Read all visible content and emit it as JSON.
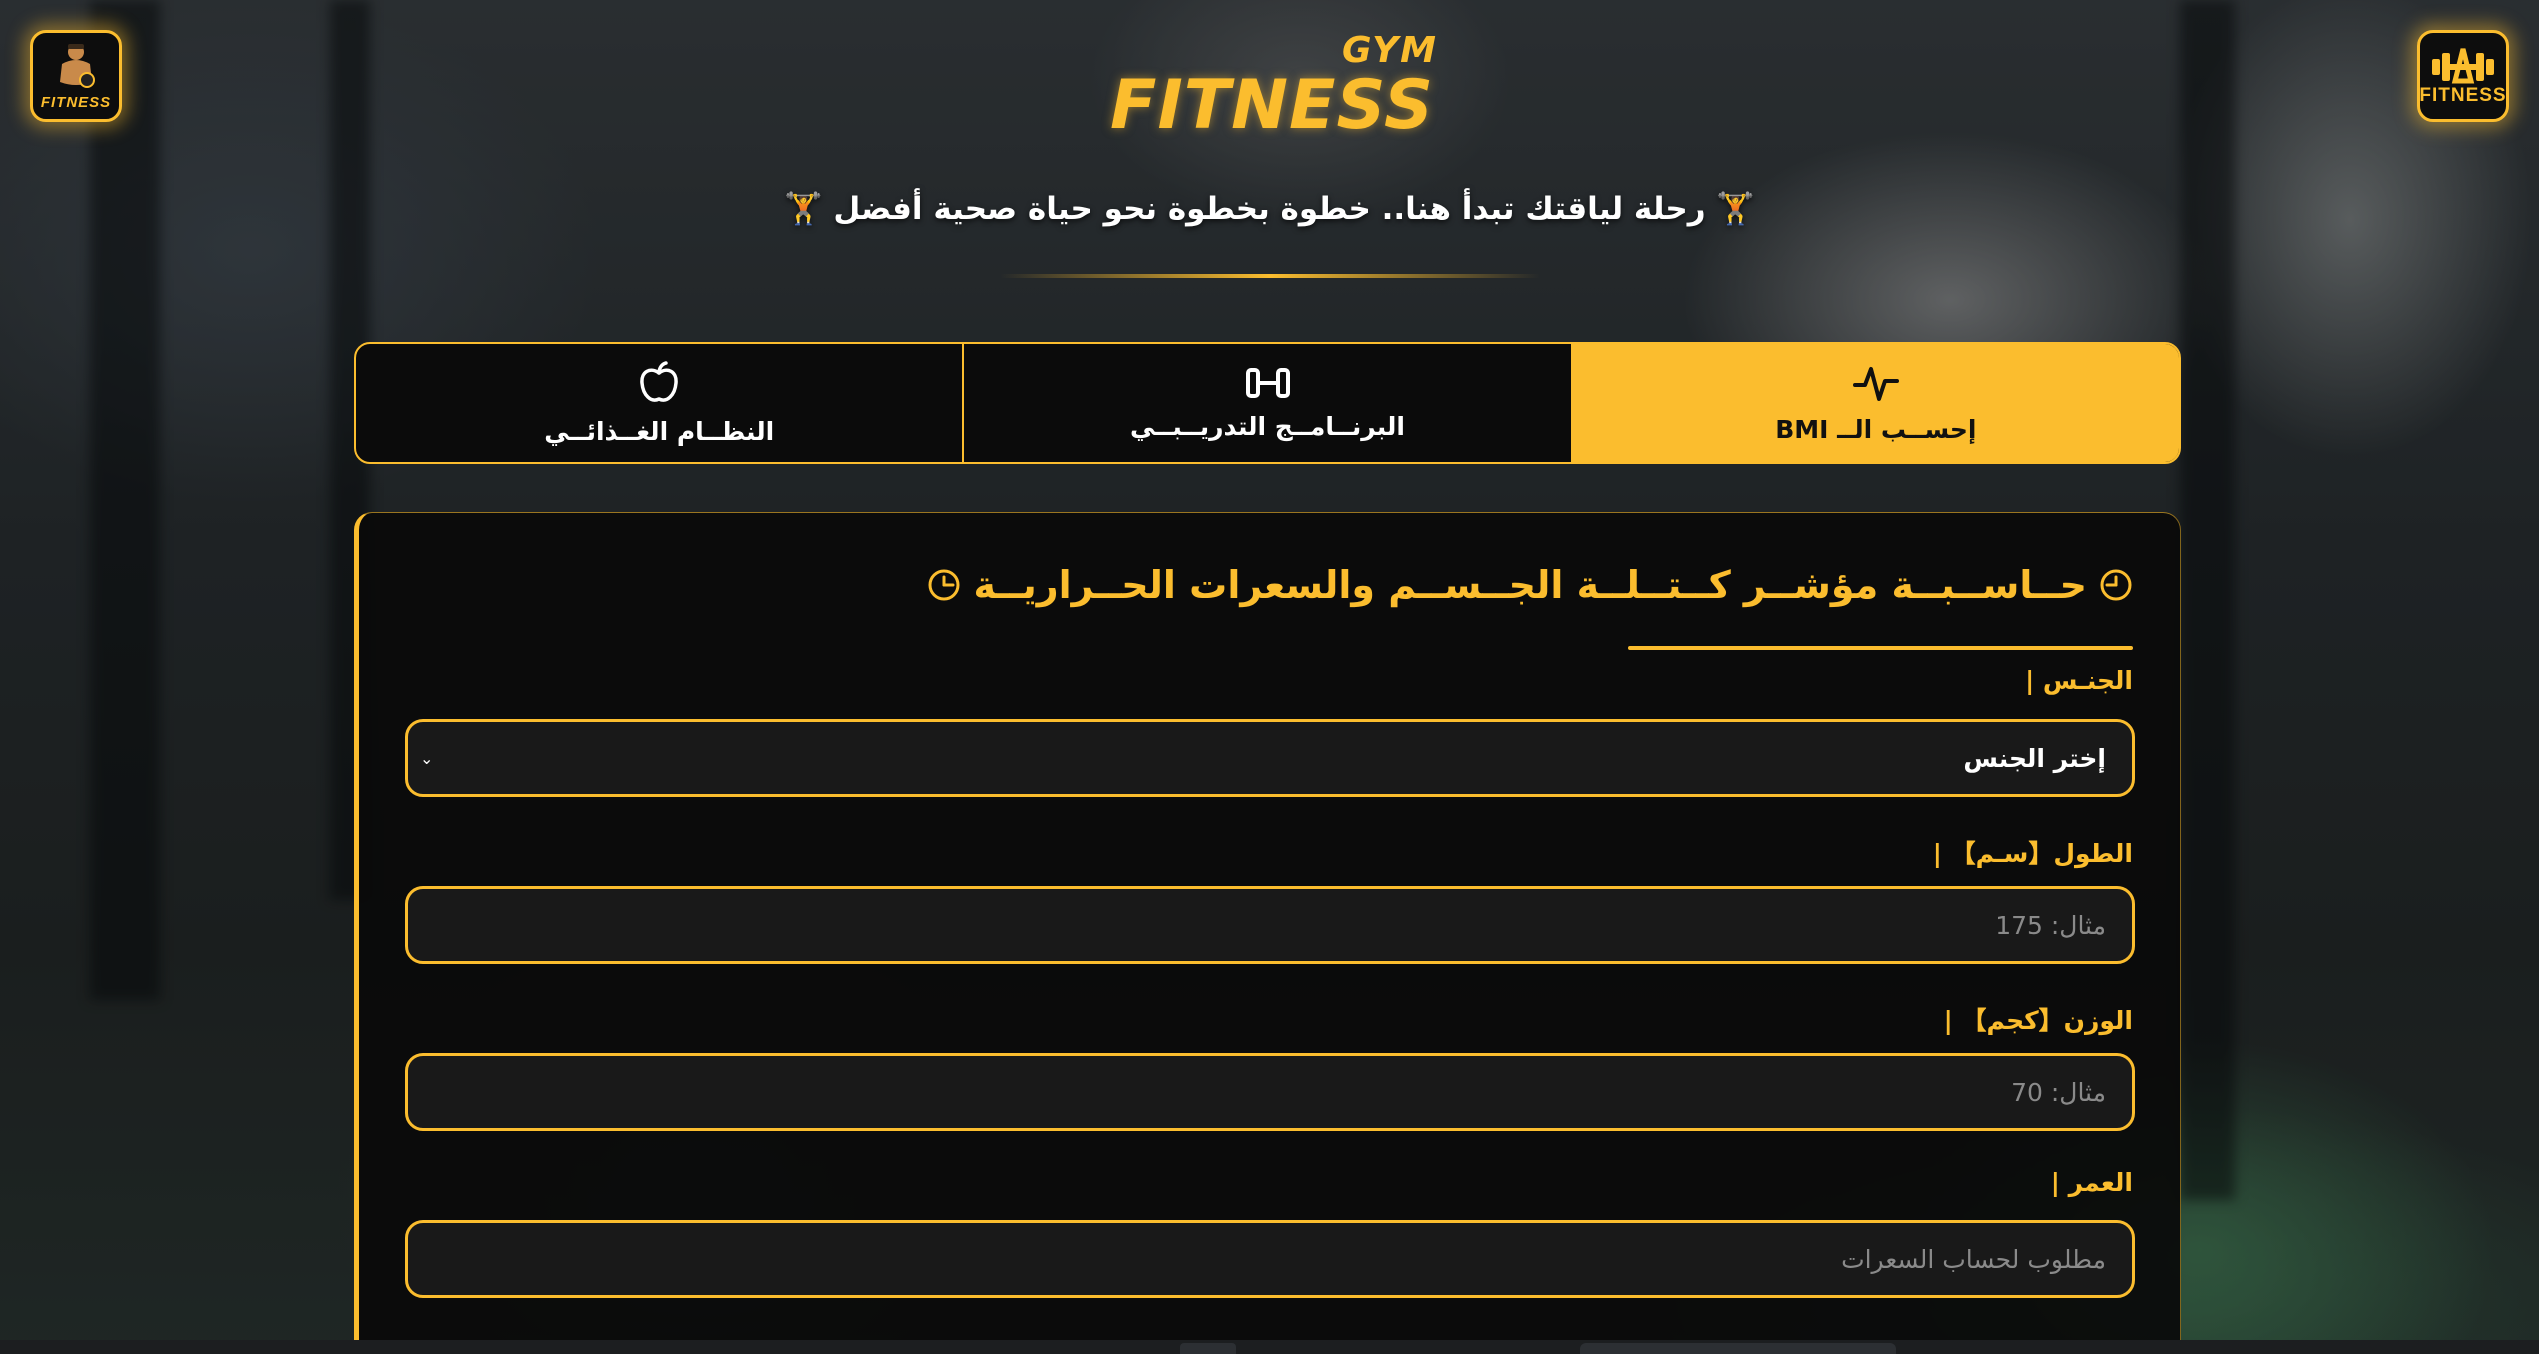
{
  "brand": {
    "main": "FITNESS",
    "sub": "GYM",
    "left_logo_text": "FITNESS",
    "right_logo_text": "FITNESS"
  },
  "tagline": "🏋 رحلة لياقتك تبدأ هنا.. خطوة بخطوة نحو حياة صحية أفضل 🏋",
  "tabs": [
    {
      "label": "إحســب الــ BMI",
      "icon": "heartbeat-icon",
      "active": true
    },
    {
      "label": "البرنــامــج التدريــبــي",
      "icon": "dumbbell-icon",
      "active": false
    },
    {
      "label": "النظــام الغــذائــي",
      "icon": "apple-icon",
      "active": false
    }
  ],
  "calculator": {
    "title": "حــاســبــة مؤشــر كــتــلــة الجــســم والسعرات الحــراريــة",
    "title_icon": "clock-icon",
    "gender": {
      "label": "الجنـس |",
      "selected": "إختر الجنس"
    },
    "height": {
      "label": "الطول【سـم】 |",
      "placeholder": "مثال: 175"
    },
    "weight": {
      "label": "الوزن【كجم】 |",
      "placeholder": "مثال: 70"
    },
    "age": {
      "label": "العمر |",
      "placeholder": "مطلوب لحساب السعرات"
    }
  },
  "colors": {
    "accent": "#fbbd2e",
    "card_bg": "#0a0a0a",
    "field_bg": "#191919"
  }
}
